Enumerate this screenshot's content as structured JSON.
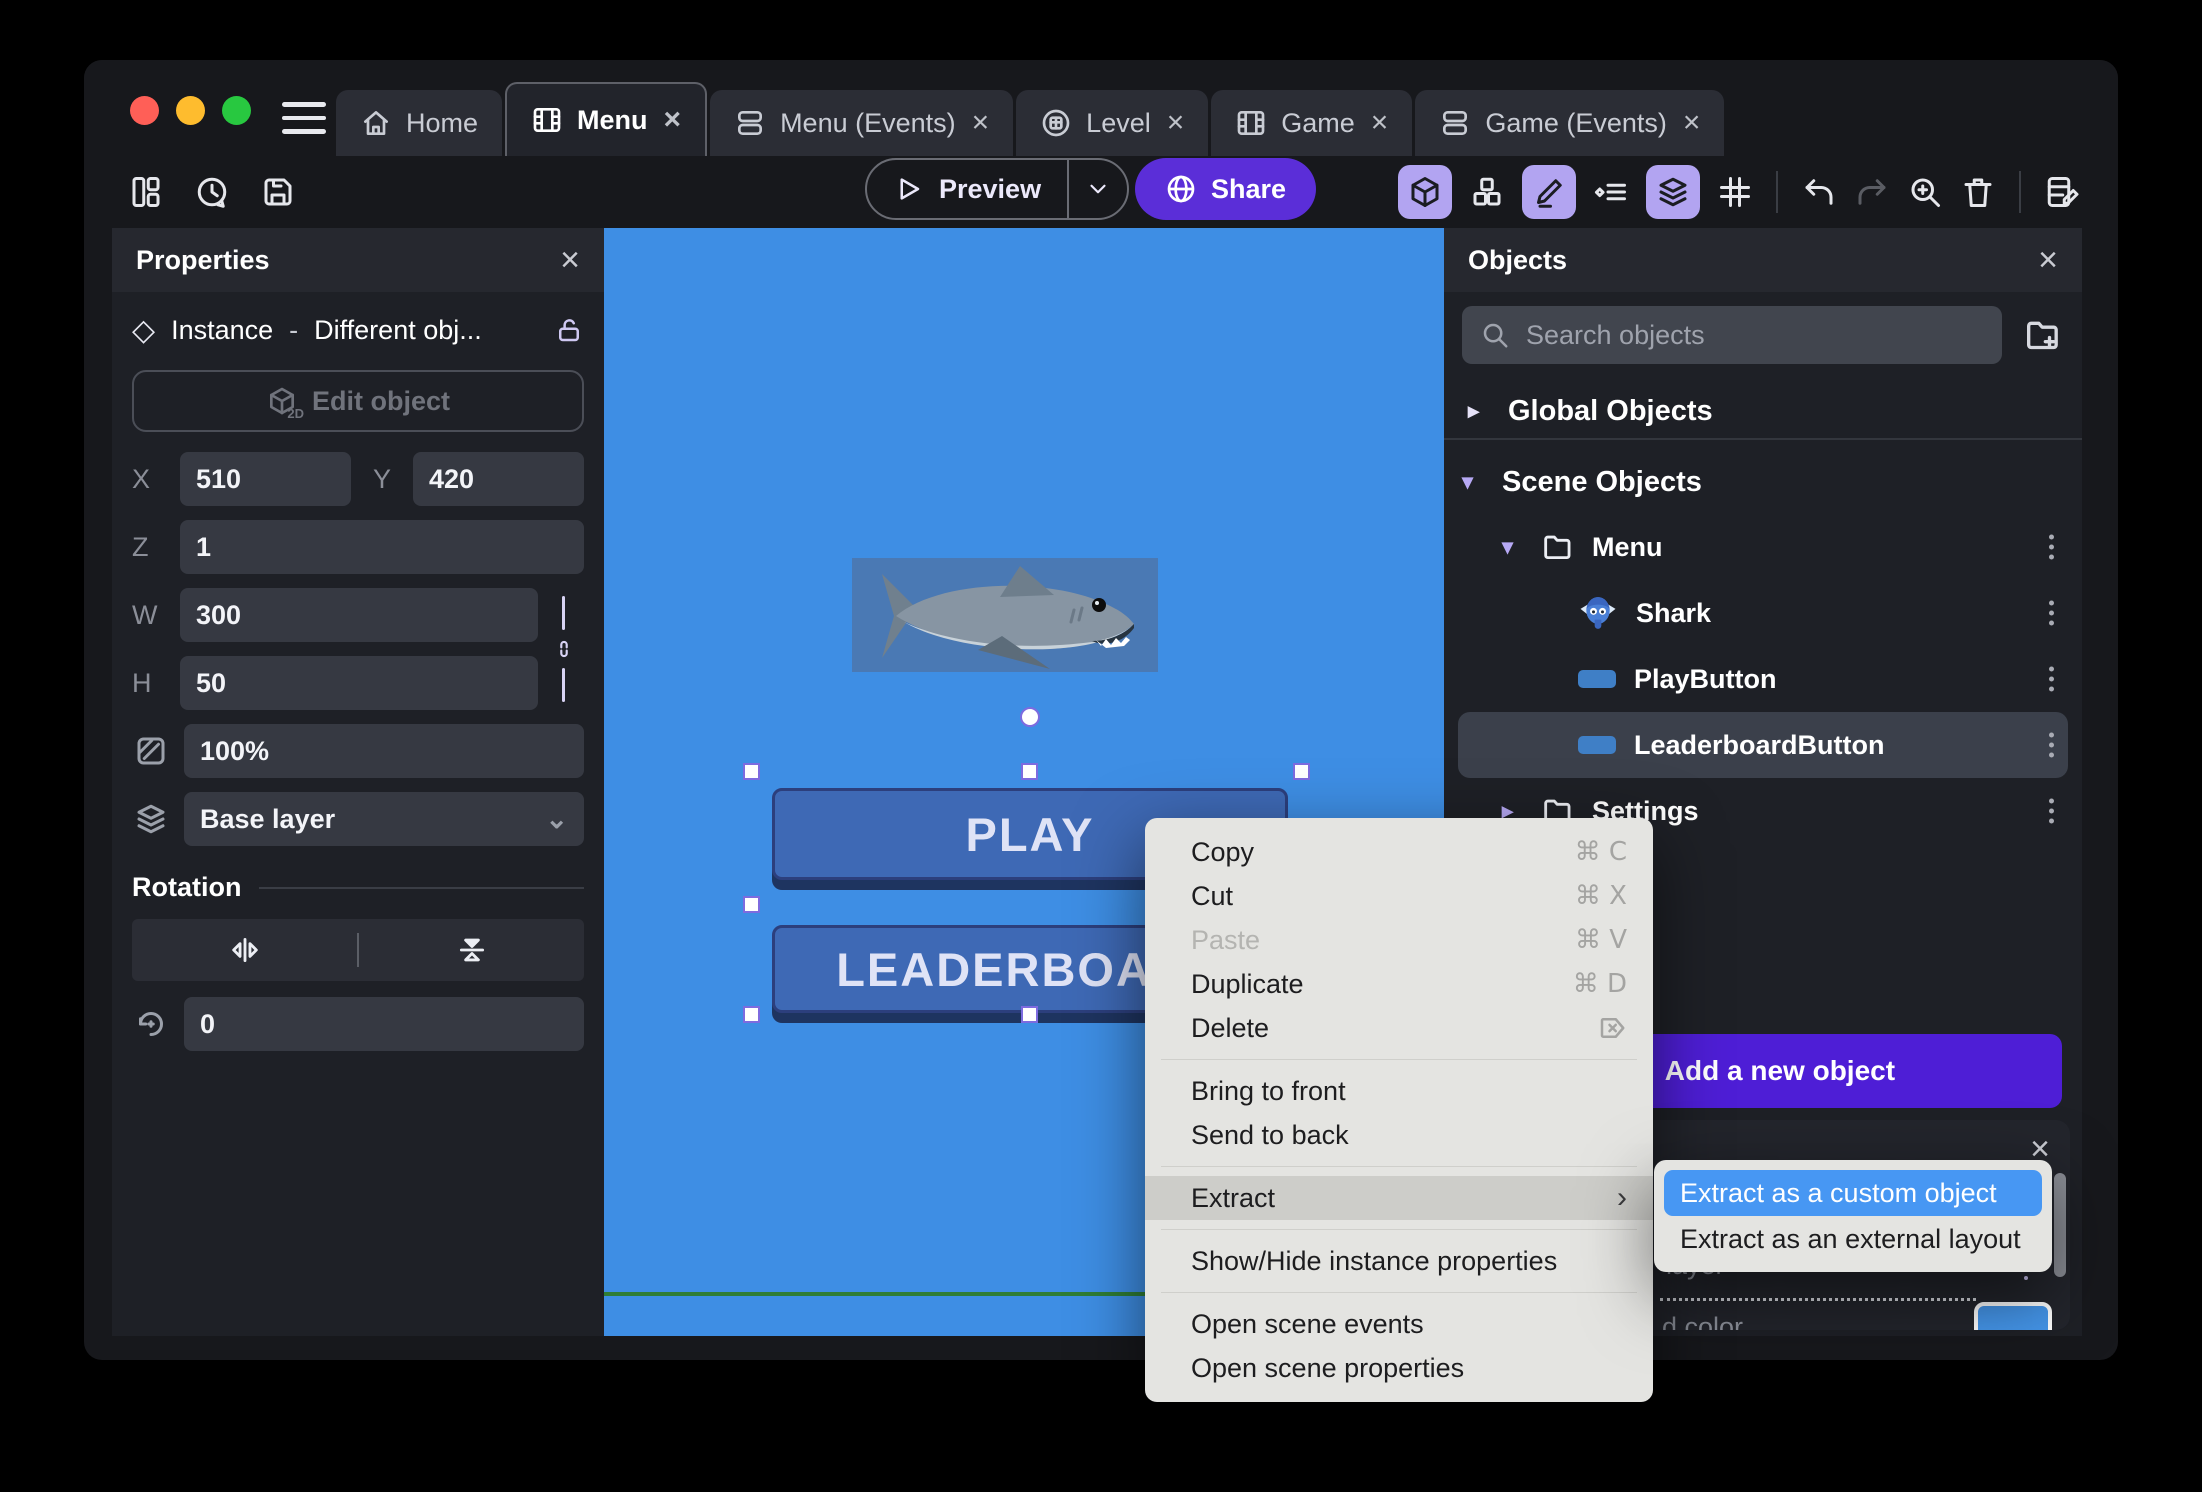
{
  "titlebar": {
    "tabs": [
      {
        "label": "Home"
      },
      {
        "label": "Menu"
      },
      {
        "label": "Menu (Events)"
      },
      {
        "label": "Level"
      },
      {
        "label": "Game"
      },
      {
        "label": "Game (Events)"
      }
    ],
    "close_glyph": "×"
  },
  "toolbar": {
    "preview": "Preview",
    "share": "Share"
  },
  "properties": {
    "title": "Properties",
    "close_glyph": "×",
    "instance_label": "Instance",
    "dash": "-",
    "instance_value": "Different obj...",
    "edit_object": "Edit object",
    "edit_object_icon_sub": "2D",
    "x_label": "X",
    "x_value": "510",
    "y_label": "Y",
    "y_value": "420",
    "z_label": "Z",
    "z_value": "1",
    "w_label": "W",
    "w_value": "300",
    "h_label": "H",
    "h_value": "50",
    "opacity_value": "100%",
    "layer_value": "Base layer",
    "layer_caret": "⌄",
    "rotation_title": "Rotation",
    "angle_value": "0"
  },
  "canvas": {
    "play": "PLAY",
    "leaderboard": "LEADERBOARD"
  },
  "objects": {
    "title": "Objects",
    "close_glyph": "×",
    "search_placeholder": "Search objects",
    "global_section": "Global Objects",
    "global_chevron": "▸",
    "scene_section": "Scene Objects",
    "scene_chevron": "▾",
    "tree": [
      {
        "label": "Menu",
        "chevron": "▾"
      },
      {
        "label": "Shark"
      },
      {
        "label": "PlayButton"
      },
      {
        "label": "LeaderboardButton"
      },
      {
        "label": "Settings",
        "chevron": "▸"
      }
    ],
    "add_plus": "+",
    "add_button": "Add a new object",
    "bottom": {
      "layer_fragment": "layer",
      "color_fragment": "d color",
      "close_glyph": "×"
    }
  },
  "context_menu": {
    "copy": "Copy",
    "copy_sc": "⌘ C",
    "cut": "Cut",
    "cut_sc": "⌘ X",
    "paste": "Paste",
    "paste_sc": "⌘ V",
    "duplicate": "Duplicate",
    "duplicate_sc": "⌘ D",
    "delete": "Delete",
    "bring_to_front": "Bring to front",
    "send_to_back": "Send to back",
    "extract": "Extract",
    "extract_chevron": "›",
    "show_hide": "Show/Hide instance properties",
    "open_events": "Open scene events",
    "open_props": "Open scene properties",
    "submenu": {
      "custom_object": "Extract as a custom object",
      "external_layout": "Extract as an external layout"
    }
  },
  "colors": {
    "accent_purple": "#4e1ed6",
    "share_purple": "#5b2ed8",
    "canvas_blue": "#3e8ee4",
    "submenu_highlight_blue": "#4797f3",
    "swatch_blue": "#4596ea",
    "selection_handle_outline": "#7d6bdf"
  }
}
